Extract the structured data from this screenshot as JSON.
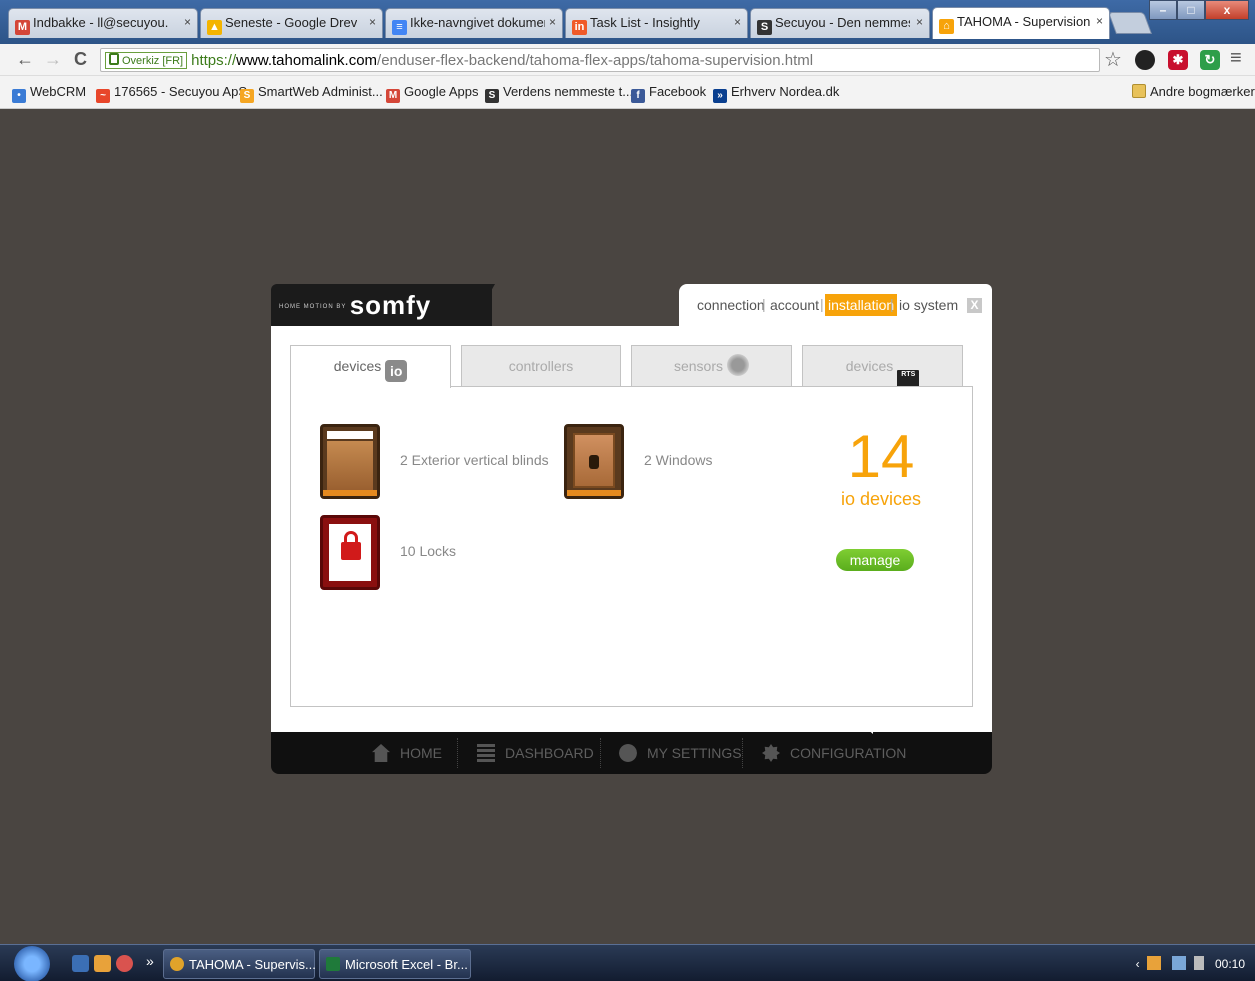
{
  "browser": {
    "tabs": [
      {
        "label": "Indbakke - ll@secuyou.d",
        "icon": "gmail-icon",
        "color": "#d44638"
      },
      {
        "label": "Seneste - Google Drev",
        "icon": "google-drive-icon",
        "color": "#f4b400"
      },
      {
        "label": "Ikke-navngivet dokumen",
        "icon": "google-docs-icon",
        "color": "#4285f4"
      },
      {
        "label": "Task List - Insightly",
        "icon": "insightly-icon",
        "color": "#f05a28"
      },
      {
        "label": "Secuyou - Den nemmest",
        "icon": "secuyou-icon",
        "color": "#333333"
      },
      {
        "label": "TAHOMA - Supervision",
        "icon": "tahoma-icon",
        "color": "#f7a30a"
      }
    ],
    "window_controls": {
      "min": "–",
      "max": "□",
      "close": "x"
    },
    "nav": {
      "back": "←",
      "forward": "→",
      "reload": "C"
    },
    "address": {
      "ev_label": "Overkiz [FR]",
      "scheme": "https://",
      "host": "www.tahomalink.com",
      "path": "/enduser-flex-backend/tahoma-flex-apps/tahoma-supervision.html"
    },
    "toolbar_icons": {
      "star": "☆",
      "menu": "≡"
    },
    "bookmarks": [
      {
        "label": "WebCRM",
        "icon": "webcrm-icon",
        "color": "#3a7bd5"
      },
      {
        "label": "176565 - Secuyou ApS",
        "icon": "flag-icon",
        "color": "#e8462a"
      },
      {
        "label": "SmartWeb Administ...",
        "icon": "smartweb-icon",
        "color": "#f5a623"
      },
      {
        "label": "Google Apps",
        "icon": "gmail-icon",
        "color": "#d44638"
      },
      {
        "label": "Verdens nemmeste t...",
        "icon": "secuyou-icon",
        "color": "#333333"
      },
      {
        "label": "Facebook",
        "icon": "facebook-icon",
        "color": "#3b5998"
      },
      {
        "label": "Erhverv Nordea.dk",
        "icon": "nordea-icon",
        "color": "#0a3f8f"
      }
    ],
    "other_bookmarks": "Andre bogmærker"
  },
  "somfy": {
    "logo_small": "HOME MOTION BY",
    "logo": "somfy",
    "accent": "#f7a30a",
    "top_nav": [
      "connection",
      "account",
      "installation",
      "io system"
    ],
    "active_top_nav": "installation",
    "close": "X",
    "device_tabs": [
      {
        "label": "devices",
        "badge": "io",
        "selected": true
      },
      {
        "label": "controllers",
        "badge": "",
        "selected": false
      },
      {
        "label": "sensors",
        "badge": "",
        "selected": false
      },
      {
        "label": "devices",
        "badge": "RTS",
        "selected": false
      }
    ],
    "devices": [
      {
        "label": "2 Exterior vertical blinds",
        "icon": "exterior-blind-icon"
      },
      {
        "label": "2 Windows",
        "icon": "window-icon"
      },
      {
        "label": "10 Locks",
        "icon": "lock-icon"
      }
    ],
    "summary": {
      "count": "14",
      "label": "io devices"
    },
    "manage_button": "manage",
    "manage_color": "#6dbe28",
    "bottom_nav": [
      {
        "label": "HOME",
        "icon": "home-icon"
      },
      {
        "label": "DASHBOARD",
        "icon": "dashboard-icon"
      },
      {
        "label": "MY SETTINGS",
        "icon": "user-icon"
      },
      {
        "label": "CONFIGURATION",
        "icon": "gear-icon"
      }
    ]
  },
  "taskbar": {
    "more": "»",
    "tasks": [
      {
        "label": "TAHOMA - Supervis...",
        "icon": "chrome-icon"
      },
      {
        "label": "Microsoft Excel - Br...",
        "icon": "excel-icon"
      }
    ],
    "clock": "00:10"
  }
}
